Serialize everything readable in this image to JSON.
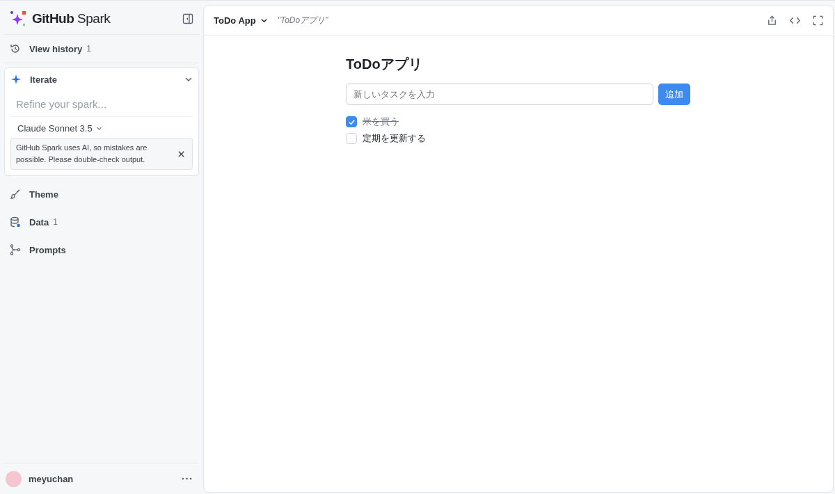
{
  "sidebar": {
    "brand": {
      "bold": "GitHub",
      "light": "Spark"
    },
    "history": {
      "label": "View history",
      "count": "1"
    },
    "iterate": {
      "title": "Iterate",
      "expanded": true,
      "placeholder": "Refine your spark...",
      "model": "Claude Sonnet 3.5",
      "notice": "GitHub Spark uses AI, so mistakes are possible. Please double-check output."
    },
    "items": [
      {
        "kind": "theme",
        "label": "Theme"
      },
      {
        "kind": "data",
        "label": "Data",
        "count": "1"
      },
      {
        "kind": "prompts",
        "label": "Prompts"
      }
    ],
    "user": {
      "name": "meyuchan"
    }
  },
  "header": {
    "app_name": "ToDo App",
    "subtitle": "\"ToDoアプリ\""
  },
  "app": {
    "title": "ToDoアプリ",
    "input_placeholder": "新しいタスクを入力",
    "add_button": "追加",
    "todos": [
      {
        "text": "米を買う",
        "checked": true
      },
      {
        "text": "定期を更新する",
        "checked": false
      }
    ]
  }
}
